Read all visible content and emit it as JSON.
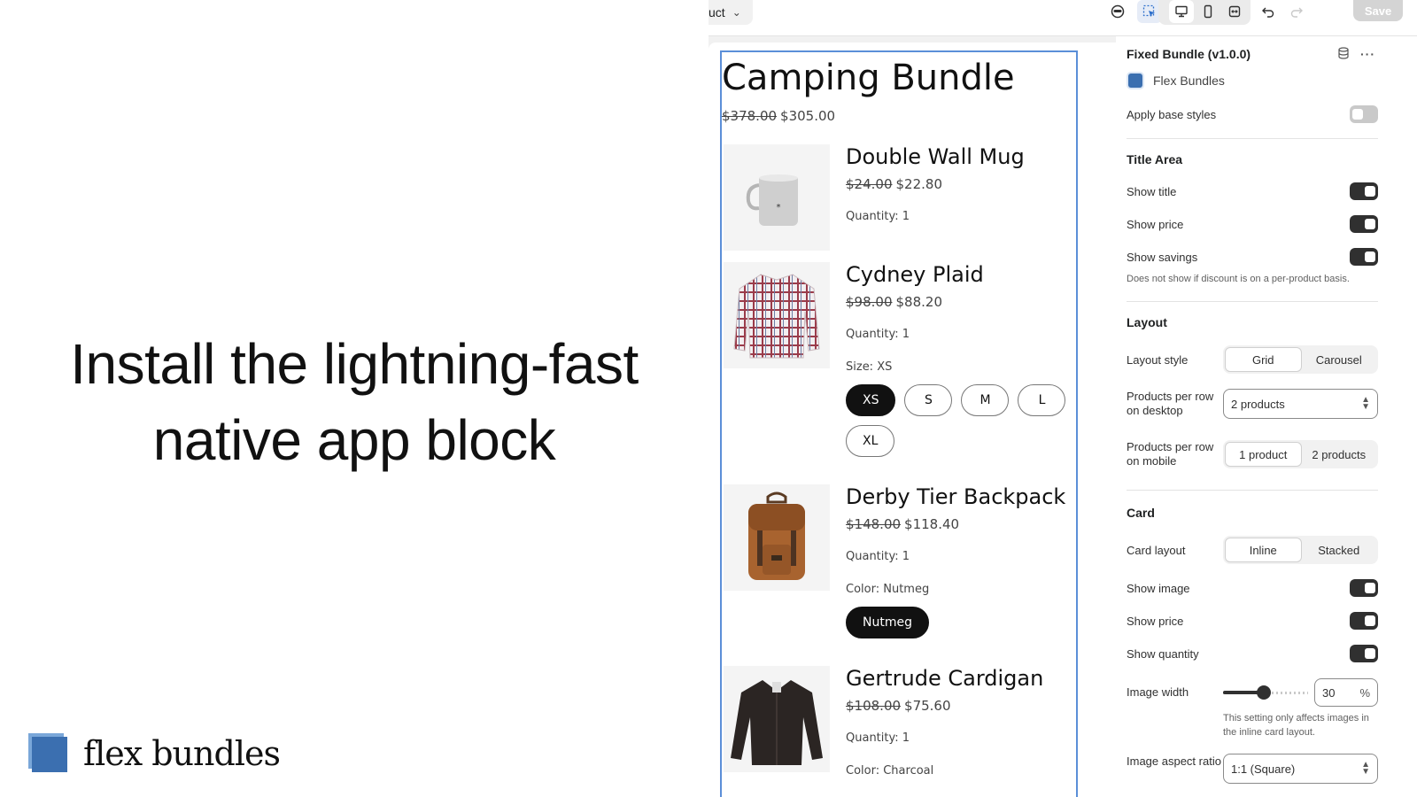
{
  "hero": {
    "line1": "Install the lightning-fast",
    "line2": "native app block",
    "brand_name": "flex bundles"
  },
  "toolbar": {
    "template_partial": "uct",
    "save_label": "Save",
    "icons": [
      "mask-icon",
      "select-element-icon",
      "desktop-icon",
      "mobile-icon",
      "fullwidth-icon",
      "undo-icon",
      "redo-icon"
    ]
  },
  "bundle": {
    "title": "Camping Bundle",
    "compare_price": "$378.00",
    "price": "$305.00",
    "products": [
      {
        "name": "Double Wall Mug",
        "compare_price": "$24.00",
        "price": "$22.80",
        "quantity": "Quantity: 1",
        "image": "mug"
      },
      {
        "name": "Cydney Plaid",
        "compare_price": "$98.00",
        "price": "$88.20",
        "quantity": "Quantity: 1",
        "option_label": "Size: XS",
        "options": [
          "XS",
          "S",
          "M",
          "L",
          "XL"
        ],
        "selected": "XS",
        "image": "plaid-shirt"
      },
      {
        "name": "Derby Tier Backpack",
        "compare_price": "$148.00",
        "price": "$118.40",
        "quantity": "Quantity: 1",
        "option_label": "Color: Nutmeg",
        "options": [
          "Nutmeg"
        ],
        "selected": "Nutmeg",
        "image": "backpack"
      },
      {
        "name": "Gertrude Cardigan",
        "compare_price": "$108.00",
        "price": "$75.60",
        "quantity": "Quantity: 1",
        "option_label": "Color: Charcoal",
        "image": "cardigan"
      }
    ]
  },
  "settings": {
    "block_title": "Fixed Bundle (v1.0.0)",
    "app_name": "Flex Bundles",
    "apply_base_styles": {
      "label": "Apply base styles",
      "on": false
    },
    "title_area": {
      "heading": "Title Area",
      "show_title": {
        "label": "Show title",
        "on": true
      },
      "show_price": {
        "label": "Show price",
        "on": true
      },
      "show_savings": {
        "label": "Show savings",
        "on": true
      },
      "savings_help": "Does not show if discount is on a per-product basis."
    },
    "layout": {
      "heading": "Layout",
      "layout_style_label": "Layout style",
      "layout_style_options": [
        "Grid",
        "Carousel"
      ],
      "layout_style_selected": "Grid",
      "per_row_desktop_label": "Products per row on desktop",
      "per_row_desktop_value": "2 products",
      "per_row_mobile_label": "Products per row on mobile",
      "per_row_mobile_options": [
        "1 product",
        "2 products"
      ],
      "per_row_mobile_selected": "1 product"
    },
    "card": {
      "heading": "Card",
      "card_layout_label": "Card layout",
      "card_layout_options": [
        "Inline",
        "Stacked"
      ],
      "card_layout_selected": "Inline",
      "show_image": {
        "label": "Show image",
        "on": true
      },
      "show_price": {
        "label": "Show price",
        "on": true
      },
      "show_quantity": {
        "label": "Show quantity",
        "on": true
      },
      "image_width_label": "Image width",
      "image_width_value": "30",
      "image_width_fraction": 0.3,
      "image_width_unit": "%",
      "image_width_help": "This setting only affects images in the inline card layout.",
      "aspect_ratio_label": "Image aspect ratio",
      "aspect_ratio_value": "1:1 (Square)"
    }
  },
  "colors": {
    "brand_blue": "#3b6fb0",
    "selection_outline": "#5b8fd8",
    "toggle_on": "#303030"
  }
}
